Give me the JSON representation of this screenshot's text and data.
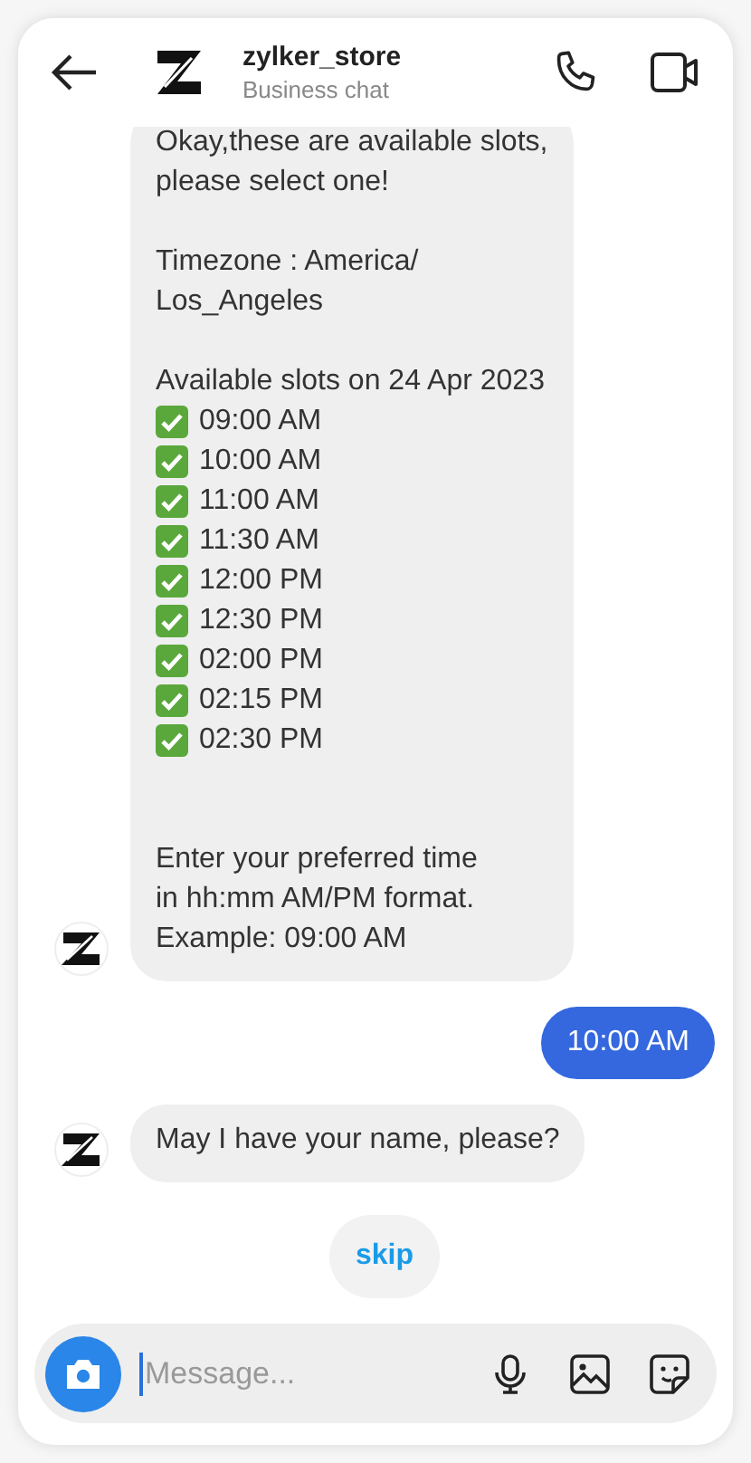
{
  "header": {
    "name": "zylker_store",
    "subtitle": "Business chat"
  },
  "messages": [
    {
      "kind": "slots",
      "intro": "Okay,these are available slots,\nplease select one!\n\nTimezone : America/\nLos_Angeles\n\nAvailable slots on 24 Apr 2023",
      "slots": [
        "09:00 AM",
        "10:00 AM",
        "11:00 AM",
        "11:30 AM",
        "12:00 PM",
        "12:30 PM",
        "02:00 PM",
        "02:15 PM",
        "02:30 PM"
      ],
      "outro": "Enter your preferred time\nin hh:mm AM/PM format.\nExample: 09:00 AM"
    },
    {
      "kind": "user",
      "text": "10:00 AM"
    },
    {
      "kind": "bot",
      "text": "May I have your name, please?"
    }
  ],
  "quick_replies": [
    "skip"
  ],
  "composer": {
    "placeholder": "Message..."
  }
}
